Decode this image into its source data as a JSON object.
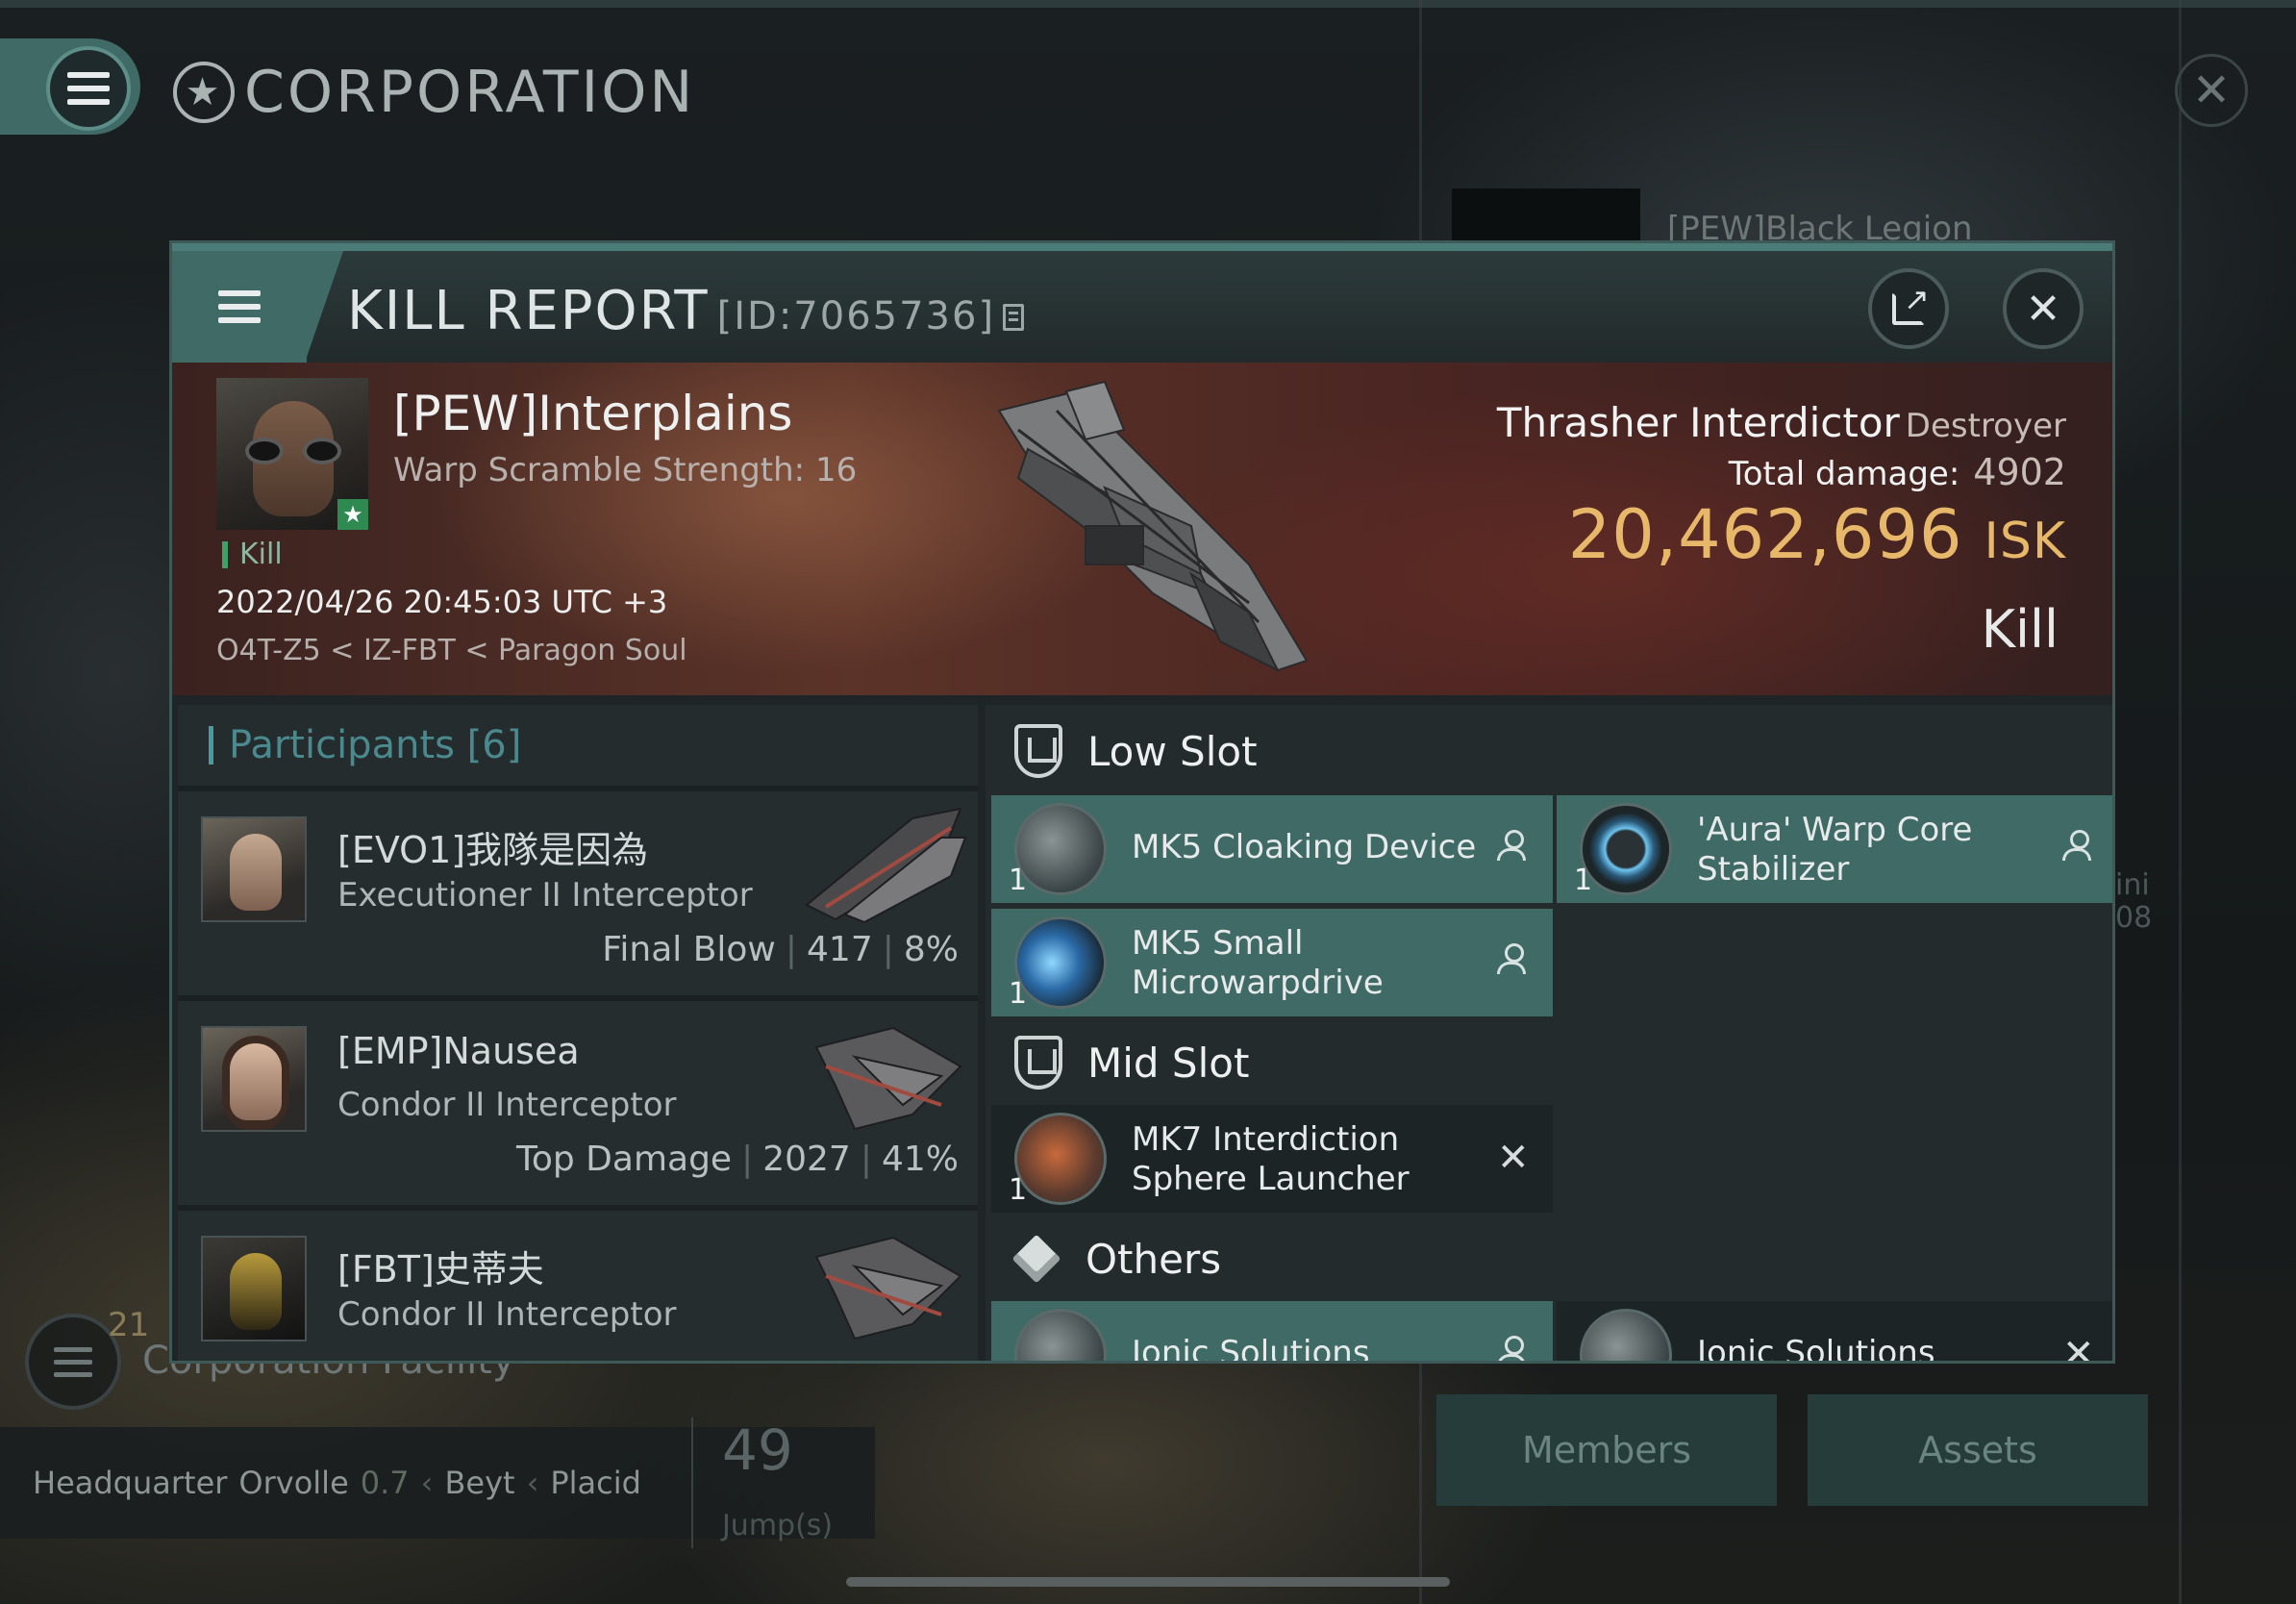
{
  "background": {
    "title": "CORPORATION",
    "corp_name": "[PEW]Black Legion",
    "facility_count": "21",
    "facility_label": "Corporation Facility",
    "hq_label": "Headquarter",
    "hq_system": "Orvolle",
    "hq_security": "0.7",
    "hq_constellation": "Beyt",
    "hq_region": "Placid",
    "jumps_value": "49",
    "jumps_label": "Jump(s)",
    "side_text_1": "ini",
    "side_text_2": "08",
    "tabs": [
      "Members",
      "Assets"
    ]
  },
  "kill_report": {
    "title": "KILL REPORT",
    "id_text": "[ID:7065736]",
    "victim": {
      "name": "[PEW]Interplains",
      "subtitle": "Warp Scramble Strength: 16",
      "tag": "Kill",
      "datetime": "2022/04/26 20:45:03 UTC +3",
      "location": "O4T-Z5 < IZ-FBT < Paragon Soul"
    },
    "ship": {
      "name": "Thrasher Interdictor",
      "class": "Destroyer",
      "total_damage_label": "Total damage:",
      "total_damage": "4902",
      "isk_value": "20,462,696",
      "isk_unit": "ISK",
      "result": "Kill"
    },
    "participants": {
      "header": "Participants [6]",
      "items": [
        {
          "name": "[EVO1]我隊是因為",
          "ship": "Executioner II Interceptor",
          "role": "Final Blow",
          "damage": "417",
          "percent": "8%"
        },
        {
          "name": "[EMP]Nausea",
          "ship": "Condor II Interceptor",
          "role": "Top Damage",
          "damage": "2027",
          "percent": "41%"
        },
        {
          "name": "[FBT]史蒂夫",
          "ship": "Condor II Interceptor",
          "role": "",
          "damage": "",
          "percent": ""
        }
      ]
    },
    "fitting": {
      "low_slot_label": "Low Slot",
      "mid_slot_label": "Mid Slot",
      "others_label": "Others",
      "low_slot": [
        {
          "name": "MK5 Cloaking Device",
          "qty": "1",
          "status": "dropped"
        },
        {
          "name": "'Aura' Warp Core Stabilizer",
          "qty": "1",
          "status": "dropped"
        },
        {
          "name": "MK5 Small Microwarpdrive",
          "qty": "1",
          "status": "dropped"
        }
      ],
      "mid_slot": [
        {
          "name": "MK7 Interdiction Sphere Launcher",
          "qty": "1",
          "status": "destroyed"
        }
      ],
      "others": [
        {
          "name": "Ionic Solutions",
          "status": "dropped"
        },
        {
          "name": "Ionic Solutions",
          "status": "destroyed"
        }
      ]
    }
  },
  "colors": {
    "accent_teal": "#3f6a66",
    "isk_gold": "#e8b86a",
    "kill_green": "#3fa068"
  }
}
